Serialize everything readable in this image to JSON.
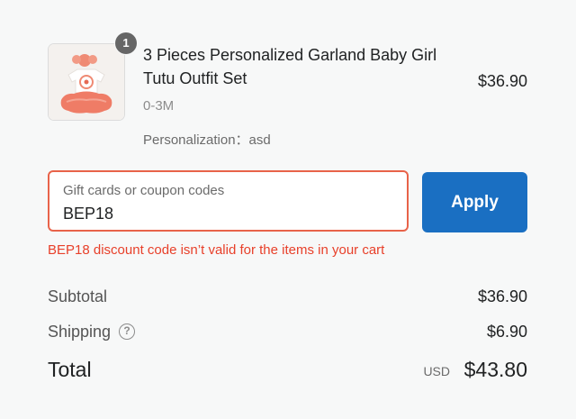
{
  "line_item": {
    "quantity": "1",
    "title": "3 Pieces Personalized Garland Baby Girl Tutu Outfit Set",
    "variant": "0-3M",
    "personalization": "Personalization：asd",
    "price": "$36.90"
  },
  "discount": {
    "label": "Gift cards or coupon codes",
    "value": "BEP18",
    "apply_label": "Apply",
    "error": "BEP18 discount code isn’t valid for the items in your cart"
  },
  "summary": {
    "subtotal_label": "Subtotal",
    "subtotal_value": "$36.90",
    "shipping_label": "Shipping",
    "shipping_value": "$6.90",
    "total_label": "Total",
    "currency": "USD",
    "total_value": "$43.80"
  },
  "colors": {
    "accent": "#1a6fc2",
    "error": "#e8402a",
    "product_pink": "#ef8a73"
  },
  "icons": {
    "help": "question-circle-icon"
  }
}
